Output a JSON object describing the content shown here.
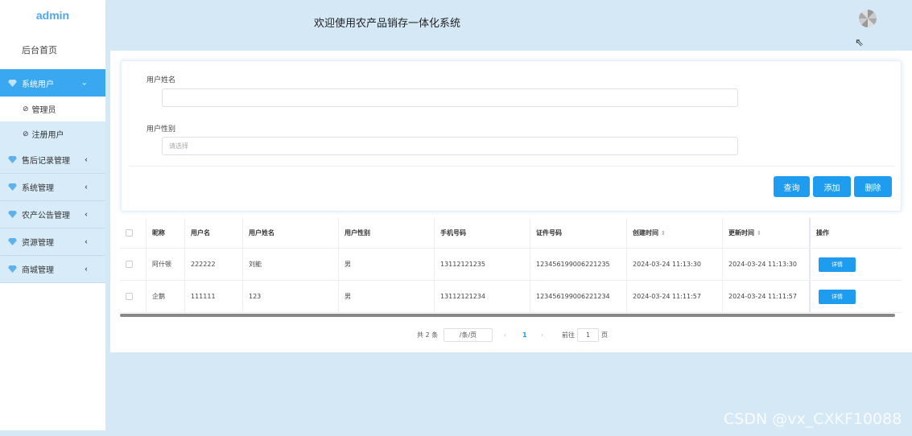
{
  "brand": "admin",
  "header": {
    "title": "欢迎使用农产品销存一体化系统"
  },
  "sidebar": {
    "home": "后台首页",
    "groups": [
      {
        "label": "系统用户",
        "arrow": "⌄",
        "subs": [
          "管理员",
          "注册用户"
        ]
      },
      {
        "label": "售后记录管理",
        "arrow": "‹"
      },
      {
        "label": "系统管理",
        "arrow": "‹"
      },
      {
        "label": "农产公告管理",
        "arrow": "‹"
      },
      {
        "label": "资源管理",
        "arrow": "‹"
      },
      {
        "label": "商城管理",
        "arrow": "‹"
      }
    ]
  },
  "search": {
    "name_label": "用户姓名",
    "name_value": "",
    "gender_label": "用户性别",
    "gender_placeholder": "请选择",
    "buttons": {
      "query": "查询",
      "add": "添加",
      "delete": "删除"
    }
  },
  "table": {
    "headers": [
      "昵称",
      "用户名",
      "用户姓名",
      "用户性别",
      "手机号码",
      "证件号码",
      "创建时间",
      "更新时间",
      "操作"
    ],
    "rows": [
      [
        "阿什顿",
        "222222",
        "刘能",
        "男",
        "13112121235",
        "123456199006221235",
        "2024-03-24 11:13:30",
        "2024-03-24 11:13:30"
      ],
      [
        "企鹅",
        "111111",
        "123",
        "男",
        "13112121234",
        "123456199006221234",
        "2024-03-24 11:11:57",
        "2024-03-24 11:11:57"
      ]
    ],
    "detail_label": "详情",
    "sort_icon": "⇕"
  },
  "pagination": {
    "total": "共 2 条",
    "page_size": "/条/页",
    "prev": "‹",
    "current": "1",
    "next": "›",
    "goto_label": "前往",
    "goto_value": "1",
    "page_unit": "页"
  },
  "watermark": "CSDN @vx_CXKF10088",
  "colors": {
    "accent": "#1e9cf0",
    "sidebar_active": "#3aa8f0",
    "background": "#d4e8f6"
  }
}
